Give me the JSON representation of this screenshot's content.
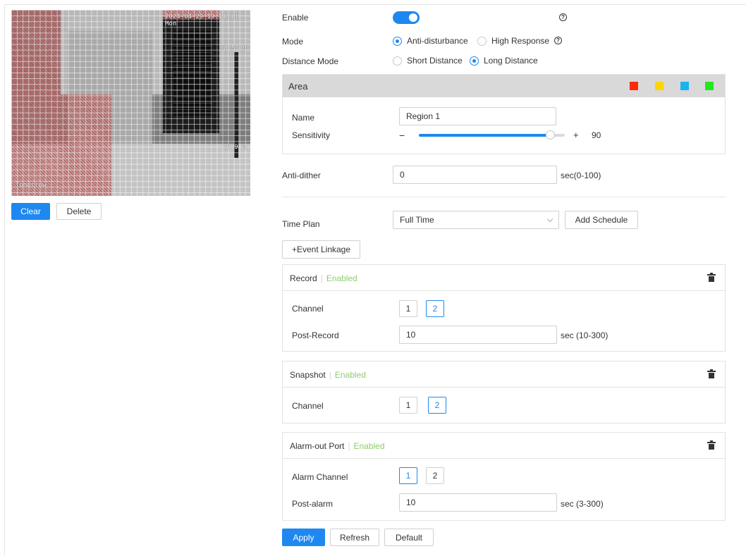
{
  "video": {
    "osd_time": "2024-04-29 19:11:18 Mon",
    "osd_a": "98.5 19",
    "osd_b": "25.9 %",
    "osd_c": "Tomorrow"
  },
  "video_actions": {
    "clear": "Clear",
    "delete": "Delete"
  },
  "enable": {
    "label": "Enable",
    "value": true
  },
  "mode": {
    "label": "Mode",
    "options": [
      "Anti-disturbance",
      "High Response"
    ],
    "selected": "Anti-disturbance"
  },
  "distance_mode": {
    "label": "Distance Mode",
    "options": [
      "Short Distance",
      "Long Distance"
    ],
    "selected": "Long Distance"
  },
  "area": {
    "title": "Area",
    "colors": [
      "#ff2a0c",
      "#ffd400",
      "#18b4f0",
      "#22e81c"
    ],
    "name_label": "Name",
    "name_value": "Region 1",
    "sensitivity_label": "Sensitivity",
    "sensitivity_minus": "−",
    "sensitivity_plus": "+",
    "sensitivity_value": "90"
  },
  "anti_dither": {
    "label": "Anti-dither",
    "value": "0",
    "unit": "sec(0-100)"
  },
  "time_plan": {
    "label": "Time Plan",
    "value": "Full Time",
    "add_schedule": "Add Schedule"
  },
  "event_linkage": "+Event Linkage",
  "record": {
    "title": "Record",
    "status": "Enabled",
    "channel_label": "Channel",
    "channels": [
      "1",
      "2"
    ],
    "selected_channel": "2",
    "post_label": "Post-Record",
    "post_value": "10",
    "post_unit": "sec (10-300)"
  },
  "snapshot": {
    "title": "Snapshot",
    "status": "Enabled",
    "channel_label": "Channel",
    "channels": [
      "1",
      "2"
    ],
    "selected_channel": "2"
  },
  "alarm_out": {
    "title": "Alarm-out Port",
    "status": "Enabled",
    "channel_label": "Alarm Channel",
    "channels": [
      "1",
      "2"
    ],
    "selected_channel": "1",
    "post_label": "Post-alarm",
    "post_value": "10",
    "post_unit": "sec (3-300)"
  },
  "footer": {
    "apply": "Apply",
    "refresh": "Refresh",
    "default": "Default"
  },
  "accent_color": "#1e88f0"
}
